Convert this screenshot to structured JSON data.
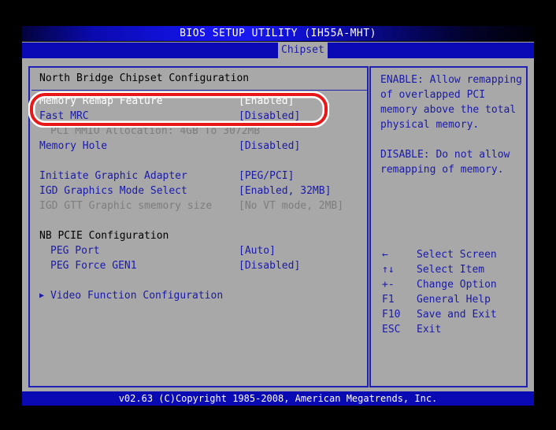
{
  "window": {
    "title": "BIOS SETUP UTILITY (IH55A-MHT)",
    "outer_background": "#000000",
    "screen_background": "#a8a8a8"
  },
  "tabs": {
    "active_label": "Chipset"
  },
  "left_panel": {
    "heading": "North Bridge Chipset Configuration",
    "rows": [
      {
        "label": "Memory Remap Feature",
        "value": "[Enabled]",
        "style": "selected-white"
      },
      {
        "label": "Fast MRC",
        "value": "[Disabled]",
        "style": "blue"
      },
      {
        "label": "PCI MMIO Allocation: 4GB To 3072MB",
        "value": "",
        "style": "grey-sub"
      },
      {
        "label": "Memory Hole",
        "value": "[Disabled]",
        "style": "blue"
      },
      {
        "label": "",
        "value": "",
        "style": "spacer"
      },
      {
        "label": "Initiate Graphic Adapter",
        "value": "[PEG/PCI]",
        "style": "blue"
      },
      {
        "label": "IGD Graphics Mode Select",
        "value": "[Enabled, 32MB]",
        "style": "blue"
      },
      {
        "label": "IGD GTT Graphic smemory size",
        "value": "[No VT mode, 2MB]",
        "style": "grey"
      },
      {
        "label": "",
        "value": "",
        "style": "spacer"
      },
      {
        "label": "NB PCIE Configuration",
        "value": "",
        "style": "black-heading"
      },
      {
        "label": "PEG Port",
        "value": "[Auto]",
        "style": "blue-sub"
      },
      {
        "label": "PEG Force GEN1",
        "value": "[Disabled]",
        "style": "blue-sub"
      },
      {
        "label": "",
        "value": "",
        "style": "spacer"
      },
      {
        "label": "Video Function Configuration",
        "value": "",
        "style": "submenu"
      }
    ],
    "submenu_arrow_glyph": "▶"
  },
  "help_panel": {
    "paragraphs": [
      "ENABLE: Allow remapping of overlapped PCI memory above the total physical memory.",
      "DISABLE: Do not allow remapping of memory."
    ],
    "keys": [
      {
        "key": "←",
        "desc": "Select Screen"
      },
      {
        "key": "↑↓",
        "desc": "Select Item"
      },
      {
        "key": "+-",
        "desc": "Change Option"
      },
      {
        "key": "F1",
        "desc": "General Help"
      },
      {
        "key": "F10",
        "desc": "Save and Exit"
      },
      {
        "key": "ESC",
        "desc": "Exit"
      }
    ]
  },
  "footer": {
    "text": "v02.63 (C)Copyright 1985-2008, American Megatrends, Inc."
  },
  "annotation": {
    "shape": "rounded-rectangle-highlight",
    "outer_color": "#e81818",
    "inner_color": "#ffffff",
    "target_row_label": "Memory Remap Feature",
    "target_row_value": "[Enabled]"
  },
  "colors": {
    "blue_text": "#1a1aa8",
    "grey_text": "#7d7d7d",
    "black_text": "#000000",
    "white_text": "#ffffff",
    "panel_border": "#2020b4",
    "title_bar_blue": "#1414e8",
    "tab_bar_blue": "#0a0ab4"
  }
}
